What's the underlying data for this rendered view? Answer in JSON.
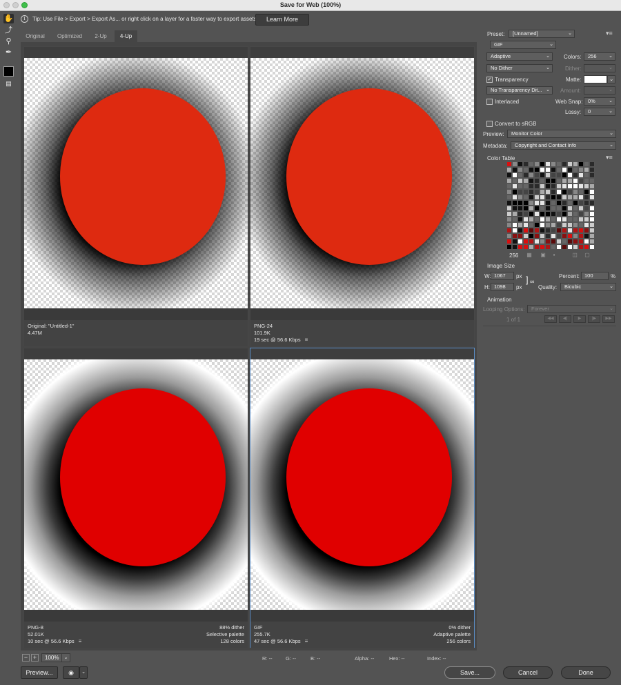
{
  "window": {
    "title": "Save for Web (100%)"
  },
  "tip": {
    "text": "Tip: Use File > Export > Export As...  or right click on a layer for a faster way to export assets",
    "learn_more": "Learn More"
  },
  "tools": [
    "hand-tool-icon",
    "slice-select-icon",
    "zoom-icon",
    "eyedropper-icon"
  ],
  "tabs": [
    {
      "label": "Original"
    },
    {
      "label": "Optimized"
    },
    {
      "label": "2-Up"
    },
    {
      "label": "4-Up",
      "active": true
    }
  ],
  "panes": [
    {
      "line1": "Original: \"Untitled-1\"",
      "line2": "4.47M",
      "line3": "",
      "r1": "",
      "r2": "",
      "r3": "",
      "disc_color": "#de2a10"
    },
    {
      "line1": "PNG-24",
      "line2": "101.9K",
      "line3": "19 sec @ 56.6 Kbps",
      "r1": "",
      "r2": "",
      "r3": "",
      "disc_color": "#de2a10"
    },
    {
      "line1": "PNG-8",
      "line2": "52.01K",
      "line3": "10 sec @ 56.6 Kbps",
      "r1": "88% dither",
      "r2": "Selective palette",
      "r3": "128 colors",
      "disc_color": "#e00000"
    },
    {
      "line1": "GIF",
      "line2": "255.7K",
      "line3": "47 sec @ 56.6 Kbps",
      "r1": "0% dither",
      "r2": "Adaptive palette",
      "r3": "256 colors",
      "disc_color": "#e00000"
    }
  ],
  "status": {
    "zoom": "100%",
    "r": "R: --",
    "g": "G: --",
    "b": "B: --",
    "alpha": "Alpha: --",
    "hex": "Hex: --",
    "index": "Index: --"
  },
  "buttons": {
    "preview": "Preview...",
    "save": "Save...",
    "cancel": "Cancel",
    "done": "Done"
  },
  "settings": {
    "preset_label": "Preset:",
    "preset": "[Unnamed]",
    "format": "GIF",
    "reduction": "Adaptive",
    "colors_label": "Colors:",
    "colors": "256",
    "dither_algo": "No Dither",
    "dither_label": "Dither:",
    "transparency_label": "Transparency",
    "transparency_checked": true,
    "matte_label": "Matte:",
    "matte_color": "#ffffff",
    "trans_dither": "No Transparency Dit...",
    "amount_label": "Amount:",
    "interlaced_label": "Interlaced",
    "interlaced_checked": false,
    "websnap_label": "Web Snap:",
    "websnap": "0%",
    "lossy_label": "Lossy:",
    "lossy": "0",
    "srgb_label": "Convert to sRGB",
    "srgb_checked": false,
    "preview_label": "Preview:",
    "preview": "Monitor Color",
    "metadata_label": "Metadata:",
    "metadata": "Copyright and Contact Info",
    "color_table_label": "Color Table",
    "color_count": "256",
    "image_size_label": "Image Size",
    "w_label": "W:",
    "w": "1067",
    "h_label": "H:",
    "h": "1098",
    "px": "px",
    "percent_label": "Percent:",
    "percent": "100",
    "pct": "%",
    "quality_label": "Quality:",
    "quality": "Bicubic",
    "animation_label": "Animation",
    "looping_label": "Looping Options:",
    "looping": "Forever",
    "frame": "1 of 1"
  }
}
